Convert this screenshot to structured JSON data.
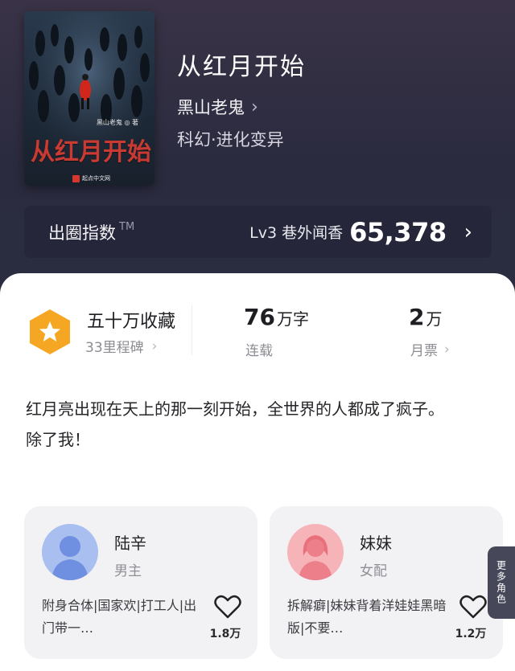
{
  "book": {
    "title": "从红月开始",
    "author": "黑山老鬼",
    "genre": "科幻·进化变异",
    "cover": {
      "title": "从红月开始",
      "author_line": "黑山老鬼 ◎ 著",
      "publisher": "起点中文网"
    }
  },
  "rank": {
    "label": "出圈指数",
    "trademark": "TM",
    "level": "Lv3 巷外闻香",
    "value": "65,378"
  },
  "stats": {
    "favorites": {
      "main": "五十万收藏",
      "sub": "33里程碑"
    },
    "words": {
      "number": "76",
      "unit": "万字",
      "sub": "连载"
    },
    "votes": {
      "number": "2",
      "unit": "万",
      "sub": "月票"
    }
  },
  "intro": {
    "line1": "红月亮出现在天上的那一刻开始，全世界的人都成了疯子。",
    "line2": "除了我！"
  },
  "characters": [
    {
      "name": "陆辛",
      "role": "男主",
      "tags": "附身合体|国家欢|打工人|出门带一…",
      "likes": "1.8万",
      "avatar_color": "#7e9be6"
    },
    {
      "name": "妹妹",
      "role": "女配",
      "tags": "拆解癖|妹妹背着洋娃娃黑暗版|不要…",
      "likes": "1.2万",
      "avatar_color": "#f08a92"
    }
  ],
  "more_roles": "更多角色",
  "colors": {
    "badge_orange": "#f5a623",
    "card_bg": "#f2f2f5",
    "header_bg": "#2c2b40"
  }
}
